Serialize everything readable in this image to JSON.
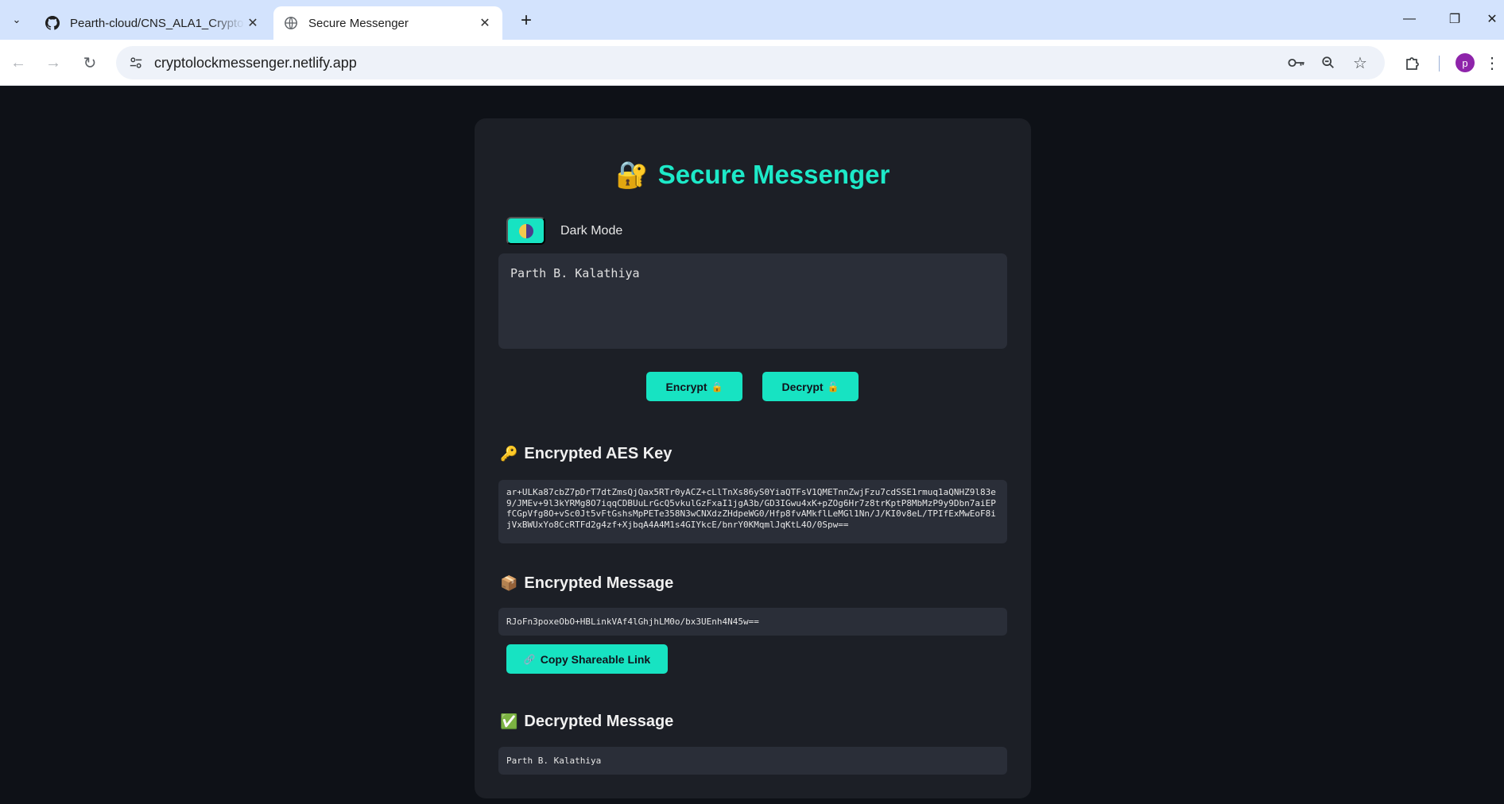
{
  "browser": {
    "tabs": [
      {
        "title": "Pearth-cloud/CNS_ALA1_Crypto",
        "icon": "github-icon",
        "active": false
      },
      {
        "title": "Secure Messenger",
        "icon": "globe-icon",
        "active": true
      }
    ],
    "address": "cryptolockmessenger.netlify.app",
    "avatar_letter": "p"
  },
  "app": {
    "title": "Secure Messenger",
    "title_icon": "🔐",
    "theme_toggle_label": "Dark Mode",
    "message_input_value": "Parth B. Kalathiya",
    "buttons": {
      "encrypt": "Encrypt",
      "encrypt_icon": "🔒",
      "decrypt": "Decrypt",
      "decrypt_icon": "🔓",
      "copy_link": "Copy Shareable Link",
      "copy_link_icon": "🔗"
    },
    "sections": {
      "aes_key_title": "Encrypted AES Key",
      "aes_key_icon": "🔑",
      "encrypted_message_title": "Encrypted Message",
      "encrypted_message_icon": "📦",
      "decrypted_message_title": "Decrypted Message",
      "decrypted_message_icon": "✅"
    },
    "encrypted_aes_key": "ar+ULKa87cbZ7pDrT7dtZmsQjQax5RTr0yACZ+cLlTnXs86yS0YiaQTFsV1QMETnnZwjFzu7cdSSE1rmuq1aQNHZ9l83e9/JMEv+9l3kYRMg8O7iqqCDBUuLrGcQ5vkulGzFxaI1jgA3b/GD3IGwu4xK+pZOg6Hr7z8trKptP8MbMzP9y9Dbn7aiEPfCGpVfg8O+vSc0Jt5vFtGshsMpPETe358N3wCNXdzZHdpeWG0/Hfp8fvAMkflLeMGl1Nn/J/KI0v8eL/TPIfExMwEoF8ijVxBWUxYo8CcRTFd2g4zf+XjbqA4A4M1s4GIYkcE/bnrY0KMqmlJqKtL4O/0Spw==",
    "encrypted_message": "RJoFn3poxeObO+HBLinkVAf4lGhjhLM0o/bx3UEnh4N45w==",
    "decrypted_message": "Parth B. Kalathiya"
  },
  "colors": {
    "accent": "#17e3c2",
    "title": "#1de9c8",
    "page_bg": "#0e1117",
    "card_bg": "#1c1f26",
    "box_bg": "#2a2e38"
  }
}
